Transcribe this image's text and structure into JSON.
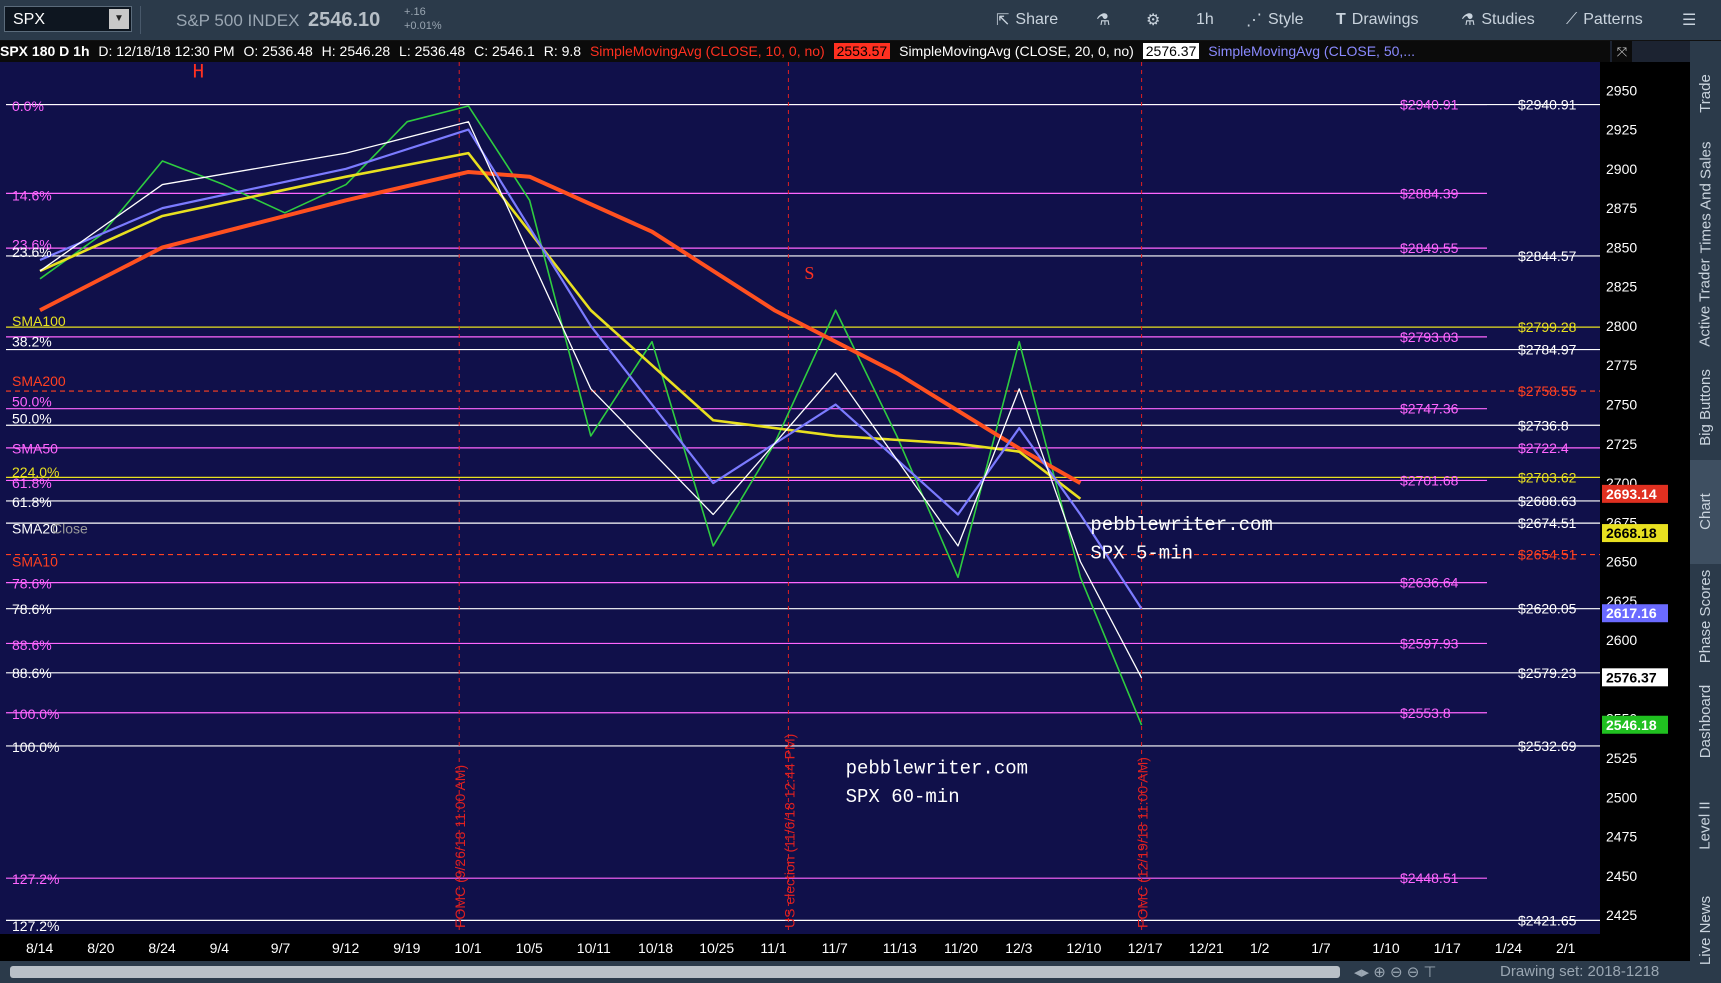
{
  "toolbar": {
    "symbol": "SPX",
    "title": "S&P 500 INDEX",
    "price": "2546.10",
    "change": "+.16",
    "change_pct": "+0.01%",
    "share": "Share",
    "interval": "1h",
    "style": "Style",
    "drawings": "Drawings",
    "studies": "Studies",
    "patterns": "Patterns"
  },
  "infobar": {
    "name": "SPX 180 D 1h",
    "date": "D: 12/18/18 12:30 PM",
    "open": "O: 2536.48",
    "high": "H: 2546.28",
    "low": "L: 2536.48",
    "close": "C: 2546.1",
    "range": "R: 9.8",
    "sma10_label": "SimpleMovingAvg (CLOSE, 10, 0, no)",
    "sma10_value": "2553.57",
    "sma20_label": "SimpleMovingAvg (CLOSE, 20, 0, no)",
    "sma20_value": "2576.37",
    "sma50_label": "SimpleMovingAvg (CLOSE, 50,..."
  },
  "sidebar": [
    "Trade",
    "Times And Sales",
    "Active Trader",
    "Big Buttons",
    "Chart",
    "Phase Scores",
    "Dashboard",
    "Level II",
    "Live News"
  ],
  "footer": {
    "drawing_set": "Drawing set: 2018-1218"
  },
  "colors": {
    "background": "#10104a",
    "up": "#2ecc40",
    "down": "#ff3020",
    "sma10": "#ff3020",
    "sma20": "#ffffff",
    "sma50": "#7b7bff",
    "sma100": "#e8e020",
    "sma200": "#ff5020",
    "fib_white": "#ffffff",
    "fib_pink": "#ff66ff"
  },
  "chart_data": {
    "type": "line",
    "title": "SPX 180 D 1h",
    "ylim": [
      2413,
      2968
    ],
    "yticks": [
      2425,
      2450,
      2475,
      2500,
      2525,
      2550,
      2575,
      2600,
      2625,
      2650,
      2675,
      2700,
      2725,
      2750,
      2775,
      2800,
      2825,
      2850,
      2875,
      2900,
      2925,
      2950
    ],
    "xticks": [
      "8/14",
      "8/20",
      "8/24",
      "9/4",
      "9/7",
      "9/12",
      "9/19",
      "10/1",
      "10/5",
      "10/11",
      "10/18",
      "10/25",
      "11/1",
      "11/7",
      "11/13",
      "11/20",
      "12/3",
      "12/10",
      "12/17",
      "12/21",
      "1/2",
      "1/7",
      "1/10",
      "1/17",
      "1/24",
      "2/1"
    ],
    "series": [
      {
        "key": "price",
        "x": [
          "8/14",
          "8/20",
          "8/24",
          "9/4",
          "9/7",
          "9/12",
          "9/19",
          "10/1",
          "10/5",
          "10/11",
          "10/18",
          "10/25",
          "11/1",
          "11/7",
          "11/13",
          "11/20",
          "12/3",
          "12/10",
          "12/17"
        ],
        "values": [
          2830,
          2858,
          2905,
          2890,
          2872,
          2890,
          2930,
          2940,
          2880,
          2730,
          2790,
          2660,
          2725,
          2810,
          2730,
          2640,
          2790,
          2640,
          2546
        ]
      },
      {
        "key": "sma200",
        "x": [
          "8/14",
          "8/24",
          "9/12",
          "10/1",
          "10/5",
          "10/18",
          "11/1",
          "11/13",
          "12/3",
          "12/10"
        ],
        "values": [
          2810,
          2850,
          2880,
          2898,
          2895,
          2860,
          2810,
          2770,
          2722,
          2700
        ]
      },
      {
        "key": "sma100",
        "x": [
          "8/14",
          "8/24",
          "9/12",
          "10/1",
          "10/11",
          "10/25",
          "11/7",
          "11/20",
          "12/3",
          "12/10"
        ],
        "values": [
          2835,
          2870,
          2895,
          2910,
          2810,
          2740,
          2730,
          2725,
          2720,
          2690
        ]
      },
      {
        "key": "sma50",
        "x": [
          "8/14",
          "8/24",
          "9/12",
          "10/1",
          "10/11",
          "10/25",
          "11/7",
          "11/20",
          "12/3",
          "12/10",
          "12/17"
        ],
        "values": [
          2842,
          2875,
          2900,
          2925,
          2800,
          2700,
          2750,
          2680,
          2735,
          2680,
          2620
        ]
      },
      {
        "key": "sma20",
        "x": [
          "8/14",
          "8/24",
          "9/12",
          "10/1",
          "10/11",
          "10/25",
          "11/7",
          "11/20",
          "12/3",
          "12/10",
          "12/17"
        ],
        "values": [
          2835,
          2890,
          2910,
          2930,
          2760,
          2680,
          2770,
          2660,
          2760,
          2650,
          2576
        ]
      }
    ],
    "left_labels": [
      {
        "text": "0.0%",
        "y": 2940,
        "color": "#ff66ff"
      },
      {
        "text": "14.6%",
        "y": 2883,
        "color": "#ff66ff"
      },
      {
        "text": "23.6%",
        "y": 2852,
        "color": "#ff66ff"
      },
      {
        "text": "23.6%",
        "y": 2847,
        "color": "#ffffff"
      },
      {
        "text": "SMA100",
        "y": 2803,
        "color": "#e8e020"
      },
      {
        "text": "38.2%",
        "y": 2790,
        "color": "#ffffff"
      },
      {
        "text": "SMA200",
        "y": 2765,
        "color": "#ff4020"
      },
      {
        "text": "50.0%",
        "y": 2752,
        "color": "#ff66ff"
      },
      {
        "text": "50.0%",
        "y": 2741,
        "color": "#ffffff"
      },
      {
        "text": "SMA50",
        "y": 2722,
        "color": "#ff66ff"
      },
      {
        "text": "224.0%",
        "y": 2707,
        "color": "#e8e020"
      },
      {
        "text": "61.8%",
        "y": 2700,
        "color": "#ff66ff"
      },
      {
        "text": "61.8%",
        "y": 2688,
        "color": "#ffffff"
      },
      {
        "text": "SMA20",
        "y": 2671,
        "color": "#ffffff"
      },
      {
        "text": "Close",
        "y": 2671,
        "color": "#9a9a9a"
      },
      {
        "text": "SMA10",
        "y": 2650,
        "color": "#ff4020"
      },
      {
        "text": "78.6%",
        "y": 2636,
        "color": "#ff66ff"
      },
      {
        "text": "78.6%",
        "y": 2620,
        "color": "#ffffff"
      },
      {
        "text": "88.6%",
        "y": 2597,
        "color": "#ff66ff"
      },
      {
        "text": "88.6%",
        "y": 2579,
        "color": "#ffffff"
      },
      {
        "text": "100.0%",
        "y": 2553,
        "color": "#ff66ff"
      },
      {
        "text": "100.0%",
        "y": 2532,
        "color": "#ffffff"
      },
      {
        "text": "127.2%",
        "y": 2448,
        "color": "#ff66ff"
      },
      {
        "text": "127.2%",
        "y": 2418,
        "color": "#ffffff"
      }
    ],
    "right_labels": [
      {
        "text": "$2940.91",
        "y": 2940.91,
        "color": "#ff66ff",
        "col": "a"
      },
      {
        "text": "$2940.91",
        "y": 2940.91,
        "color": "#ffffff",
        "col": "b"
      },
      {
        "text": "$2884.39",
        "y": 2884.39,
        "color": "#ff66ff",
        "col": "a"
      },
      {
        "text": "$2849.55",
        "y": 2849.55,
        "color": "#ff66ff",
        "col": "a"
      },
      {
        "text": "$2844.57",
        "y": 2844.57,
        "color": "#ffffff",
        "col": "b"
      },
      {
        "text": "$2799.28",
        "y": 2799.28,
        "color": "#e8e020",
        "col": "b"
      },
      {
        "text": "$2793.03",
        "y": 2793.03,
        "color": "#ff66ff",
        "col": "a"
      },
      {
        "text": "$2784.97",
        "y": 2784.97,
        "color": "#ffffff",
        "col": "b"
      },
      {
        "text": "$2758.55",
        "y": 2758.55,
        "color": "#ff4020",
        "col": "b"
      },
      {
        "text": "$2747.36",
        "y": 2747.36,
        "color": "#ff66ff",
        "col": "a"
      },
      {
        "text": "$2736.8",
        "y": 2736.8,
        "color": "#ffffff",
        "col": "b"
      },
      {
        "text": "$2722.4",
        "y": 2722.4,
        "color": "#ff66ff",
        "col": "b"
      },
      {
        "text": "$2703.62",
        "y": 2703.62,
        "color": "#e8e020",
        "col": "b"
      },
      {
        "text": "$2701.68",
        "y": 2701.68,
        "color": "#ff66ff",
        "col": "a"
      },
      {
        "text": "$2688.63",
        "y": 2688.63,
        "color": "#ffffff",
        "col": "b"
      },
      {
        "text": "$2674.51",
        "y": 2674.51,
        "color": "#ffffff",
        "col": "b"
      },
      {
        "text": "$2654.51",
        "y": 2654.51,
        "color": "#ff4020",
        "col": "b"
      },
      {
        "text": "$2636.64",
        "y": 2636.64,
        "color": "#ff66ff",
        "col": "a"
      },
      {
        "text": "$2620.05",
        "y": 2620.05,
        "color": "#ffffff",
        "col": "b"
      },
      {
        "text": "$2597.93",
        "y": 2597.93,
        "color": "#ff66ff",
        "col": "a"
      },
      {
        "text": "$2579.23",
        "y": 2579.23,
        "color": "#ffffff",
        "col": "b"
      },
      {
        "text": "$2553.8",
        "y": 2553.8,
        "color": "#ff66ff",
        "col": "a"
      },
      {
        "text": "$2532.69",
        "y": 2532.69,
        "color": "#ffffff",
        "col": "b"
      },
      {
        "text": "$2448.51",
        "y": 2448.51,
        "color": "#ff66ff",
        "col": "a"
      },
      {
        "text": "$2421.65",
        "y": 2421.65,
        "color": "#ffffff",
        "col": "b"
      }
    ],
    "axis_badges": [
      {
        "text": "2693.14",
        "y": 2693.14,
        "bg": "#e03020",
        "fg": "#ffffff"
      },
      {
        "text": "2668.18",
        "y": 2668.18,
        "bg": "#e8e020",
        "fg": "#000000"
      },
      {
        "text": "2617.16",
        "y": 2617.16,
        "bg": "#6a6aff",
        "fg": "#ffffff"
      },
      {
        "text": "2576.37",
        "y": 2576.37,
        "bg": "#ffffff",
        "fg": "#000000"
      },
      {
        "text": "2546.18",
        "y": 2546.18,
        "bg": "#20c020",
        "fg": "#ffffff"
      }
    ],
    "annotations": [
      {
        "text": "H",
        "x": "8/24",
        "y": 2958,
        "color": "#ff3020",
        "size": 20
      },
      {
        "text": "S",
        "x": "11/1",
        "y": 2830,
        "color": "#ff3020",
        "size": 18
      },
      {
        "text": "pebblewriter.com",
        "x": "12/10",
        "y": 2670,
        "color": "#ffffff",
        "size": 19
      },
      {
        "text": "SPX  5-min",
        "x": "12/10",
        "y": 2652,
        "color": "#ffffff",
        "size": 19
      },
      {
        "text": "pebblewriter.com",
        "x": "11/7",
        "y": 2515,
        "color": "#ffffff",
        "size": 19
      },
      {
        "text": "SPX  60-min",
        "x": "11/7",
        "y": 2497,
        "color": "#ffffff",
        "size": 19
      }
    ],
    "vertical_notes": [
      {
        "text": "FOMC (9/26/18 11:00 AM)",
        "x": "9/19"
      },
      {
        "text": "US election (11/6/18 12:44 PM)",
        "x": "11/1"
      },
      {
        "text": "FOMC (12/19/18 11:00 AM)",
        "x": "12/17"
      }
    ]
  }
}
